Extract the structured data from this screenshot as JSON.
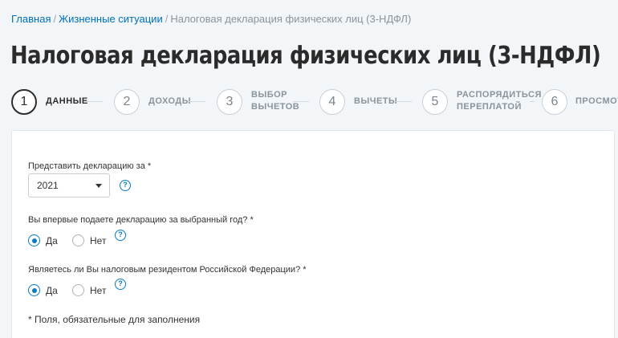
{
  "breadcrumb": {
    "items": [
      "Главная",
      "Жизненные ситуации"
    ],
    "current": "Налоговая декларация физических лиц (3-НДФЛ)",
    "separator": "/"
  },
  "page_title": "Налоговая декларация физических лиц (3-НДФЛ)",
  "stepper": {
    "steps": [
      {
        "number": "1",
        "label_lines": [
          "ДАННЫЕ"
        ],
        "active": true
      },
      {
        "number": "2",
        "label_lines": [
          "ДОХОДЫ"
        ],
        "active": false
      },
      {
        "number": "3",
        "label_lines": [
          "ВЫБОР",
          "ВЫЧЕТОВ"
        ],
        "active": false
      },
      {
        "number": "4",
        "label_lines": [
          "ВЫЧЕТЫ"
        ],
        "active": false
      },
      {
        "number": "5",
        "label_lines": [
          "РАСПОРЯДИТЬСЯ",
          "ПЕРЕПЛАТОЙ"
        ],
        "active": false
      },
      {
        "number": "6",
        "label_lines": [
          "ПРОСМОТР"
        ],
        "active": false
      }
    ]
  },
  "form": {
    "year_label": "Представить декларацию за *",
    "year_value": "2021",
    "first_time_label": "Вы впервые подаете декларацию за выбранный год? *",
    "first_time_yes": "Да",
    "first_time_no": "Нет",
    "first_time_selected": "yes",
    "resident_label": "Являетесь ли Вы налоговым резидентом Российской Федерации? *",
    "resident_yes": "Да",
    "resident_no": "Нет",
    "resident_selected": "yes",
    "help_glyph": "?",
    "required_note": "* Поля, обязательные для заполнения"
  },
  "colors": {
    "link": "#0070b8",
    "accent": "#0a7cc4",
    "background": "#f2f6f9",
    "text": "#333333"
  },
  "icons": {
    "select_caret": "chevron-down-icon",
    "help": "question-circle-icon"
  }
}
